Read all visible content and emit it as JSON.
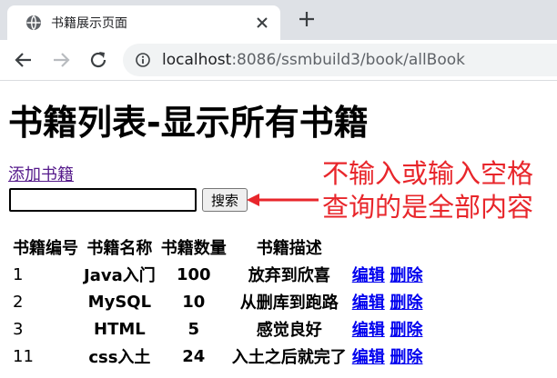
{
  "browser": {
    "tab_title": "书籍展示页面",
    "url_host": "localhost",
    "url_path": ":8086/ssmbuild3/book/allBook"
  },
  "page": {
    "title": "书籍列表-显示所有书籍",
    "add_link": "添加书籍",
    "search_value": "",
    "search_button": "搜索"
  },
  "annotation": {
    "line1": "不输入或输入空格",
    "line2": "查询的是全部内容",
    "color": "#e8262b"
  },
  "table": {
    "headers": [
      "书籍编号",
      "书籍名称",
      "书籍数量",
      "书籍描述"
    ],
    "rows": [
      {
        "id": "1",
        "name": "Java入门",
        "count": "100",
        "detail": "放弃到欣喜",
        "edit": "编辑",
        "delete": "删除"
      },
      {
        "id": "2",
        "name": "MySQL",
        "count": "10",
        "detail": "从删库到跑路",
        "edit": "编辑",
        "delete": "删除"
      },
      {
        "id": "3",
        "name": "HTML",
        "count": "5",
        "detail": "感觉良好",
        "edit": "编辑",
        "delete": "删除"
      },
      {
        "id": "11",
        "name": "css入土",
        "count": "24",
        "detail": "入土之后就完了",
        "edit": "编辑",
        "delete": "删除"
      }
    ]
  },
  "icons": {
    "favicon": "globe-icon",
    "close": "close-icon",
    "new_tab": "plus-icon",
    "back": "back-arrow-icon",
    "forward": "forward-arrow-icon",
    "reload": "reload-icon",
    "info": "info-icon"
  }
}
